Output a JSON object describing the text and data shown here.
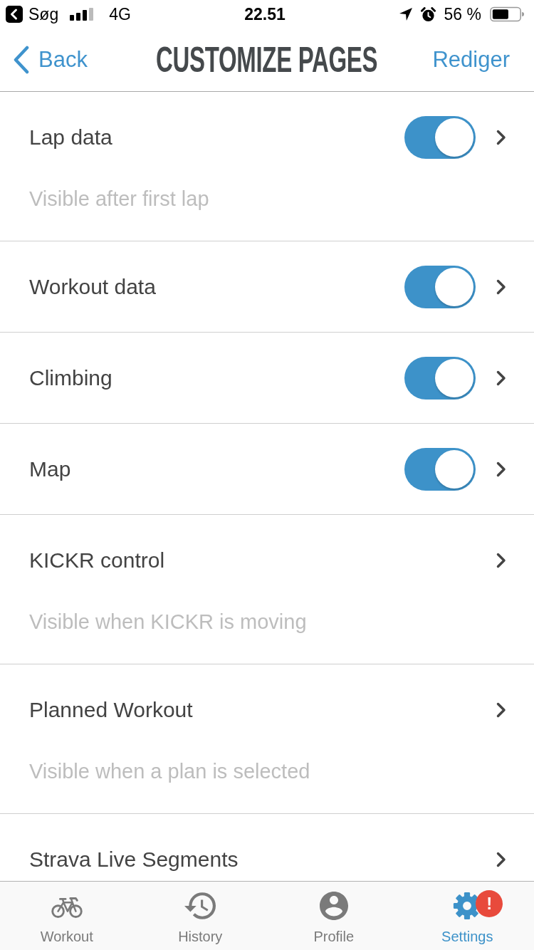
{
  "status_bar": {
    "return_label": "Søg",
    "network": "4G",
    "time": "22.51",
    "battery": "56 %"
  },
  "nav": {
    "back": "Back",
    "title": "CUSTOMIZE PAGES",
    "action": "Rediger"
  },
  "pages": [
    {
      "kind": "switch",
      "title": "Lap data",
      "on": true,
      "note": "Visible after first lap"
    },
    {
      "kind": "switch",
      "title": "Workout data",
      "on": true
    },
    {
      "kind": "switch",
      "title": "Climbing",
      "on": true
    },
    {
      "kind": "switch",
      "title": "Map",
      "on": true
    },
    {
      "kind": "link",
      "title": "KICKR control",
      "note": "Visible when KICKR is moving"
    },
    {
      "kind": "link",
      "title": "Planned Workout",
      "note": "Visible when a plan is selected"
    },
    {
      "kind": "link",
      "title": "Strava Live Segments"
    }
  ],
  "tabs": [
    {
      "label": "Workout",
      "selected": false
    },
    {
      "label": "History",
      "selected": false
    },
    {
      "label": "Profile",
      "selected": false
    },
    {
      "label": "Settings",
      "selected": true,
      "badge": "!"
    }
  ]
}
